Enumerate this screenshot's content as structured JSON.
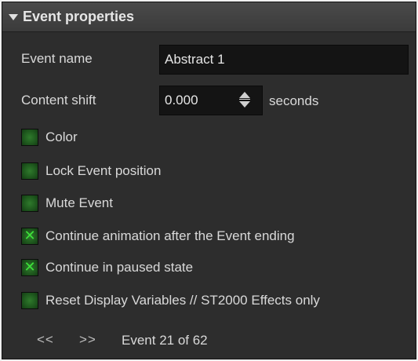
{
  "header": {
    "title": "Event properties",
    "collapse_icon": "triangle-down-icon"
  },
  "fields": {
    "event_name_label": "Event name",
    "event_name_value": "Abstract 1",
    "content_shift_label": "Content shift",
    "content_shift_value": "0.000",
    "content_shift_unit": "seconds",
    "spinner_icon": "up-down-spinner-icon"
  },
  "options": [
    {
      "label": "Color",
      "checked": false
    },
    {
      "label": "Lock Event position",
      "checked": false
    },
    {
      "label": "Mute Event",
      "checked": false
    },
    {
      "label": "Continue animation after the Event ending",
      "checked": true
    },
    {
      "label": "Continue in paused state",
      "checked": true
    },
    {
      "label": "Reset Display Variables // ST2000 Effects only",
      "checked": false
    }
  ],
  "navigation": {
    "prev_label": "<<",
    "next_label": ">>",
    "status": "Event 21 of 62"
  },
  "colors": {
    "panel_bg": "#2d2d2d",
    "checkbox_green": "#1f5a1e",
    "check_mark": "#3ee23a",
    "input_bg": "#141414"
  }
}
